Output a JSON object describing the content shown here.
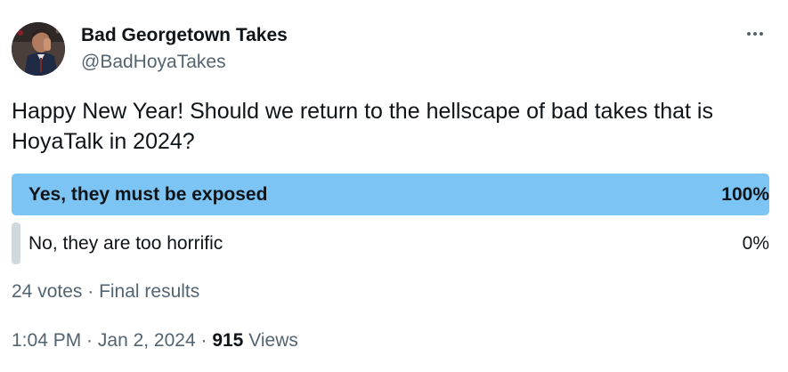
{
  "author": {
    "name": "Bad Georgetown Takes",
    "handle": "@BadHoyaTakes"
  },
  "more_icon": "more-horizontal-icon",
  "tweet_text": "Happy New Year! Should we return to the hellscape of bad takes that is HoyaTalk in 2024?",
  "poll": {
    "options": [
      {
        "label": "Yes, they must be exposed",
        "percent": "100%",
        "fraction": 1.0,
        "winner": true
      },
      {
        "label": "No, they are too horrific",
        "percent": "0%",
        "fraction": 0.0,
        "winner": false
      }
    ],
    "votes": "24 votes",
    "separator": " · ",
    "status": "Final results"
  },
  "meta": {
    "time": "1:04 PM",
    "separator": " · ",
    "date": "Jan 2, 2024",
    "views_count": "915",
    "views_label": "Views"
  },
  "colors": {
    "winner_bar": "#7cc4f3",
    "loser_bar": "#cfd9de",
    "secondary_text": "#536471",
    "primary_text": "#0f1419"
  }
}
